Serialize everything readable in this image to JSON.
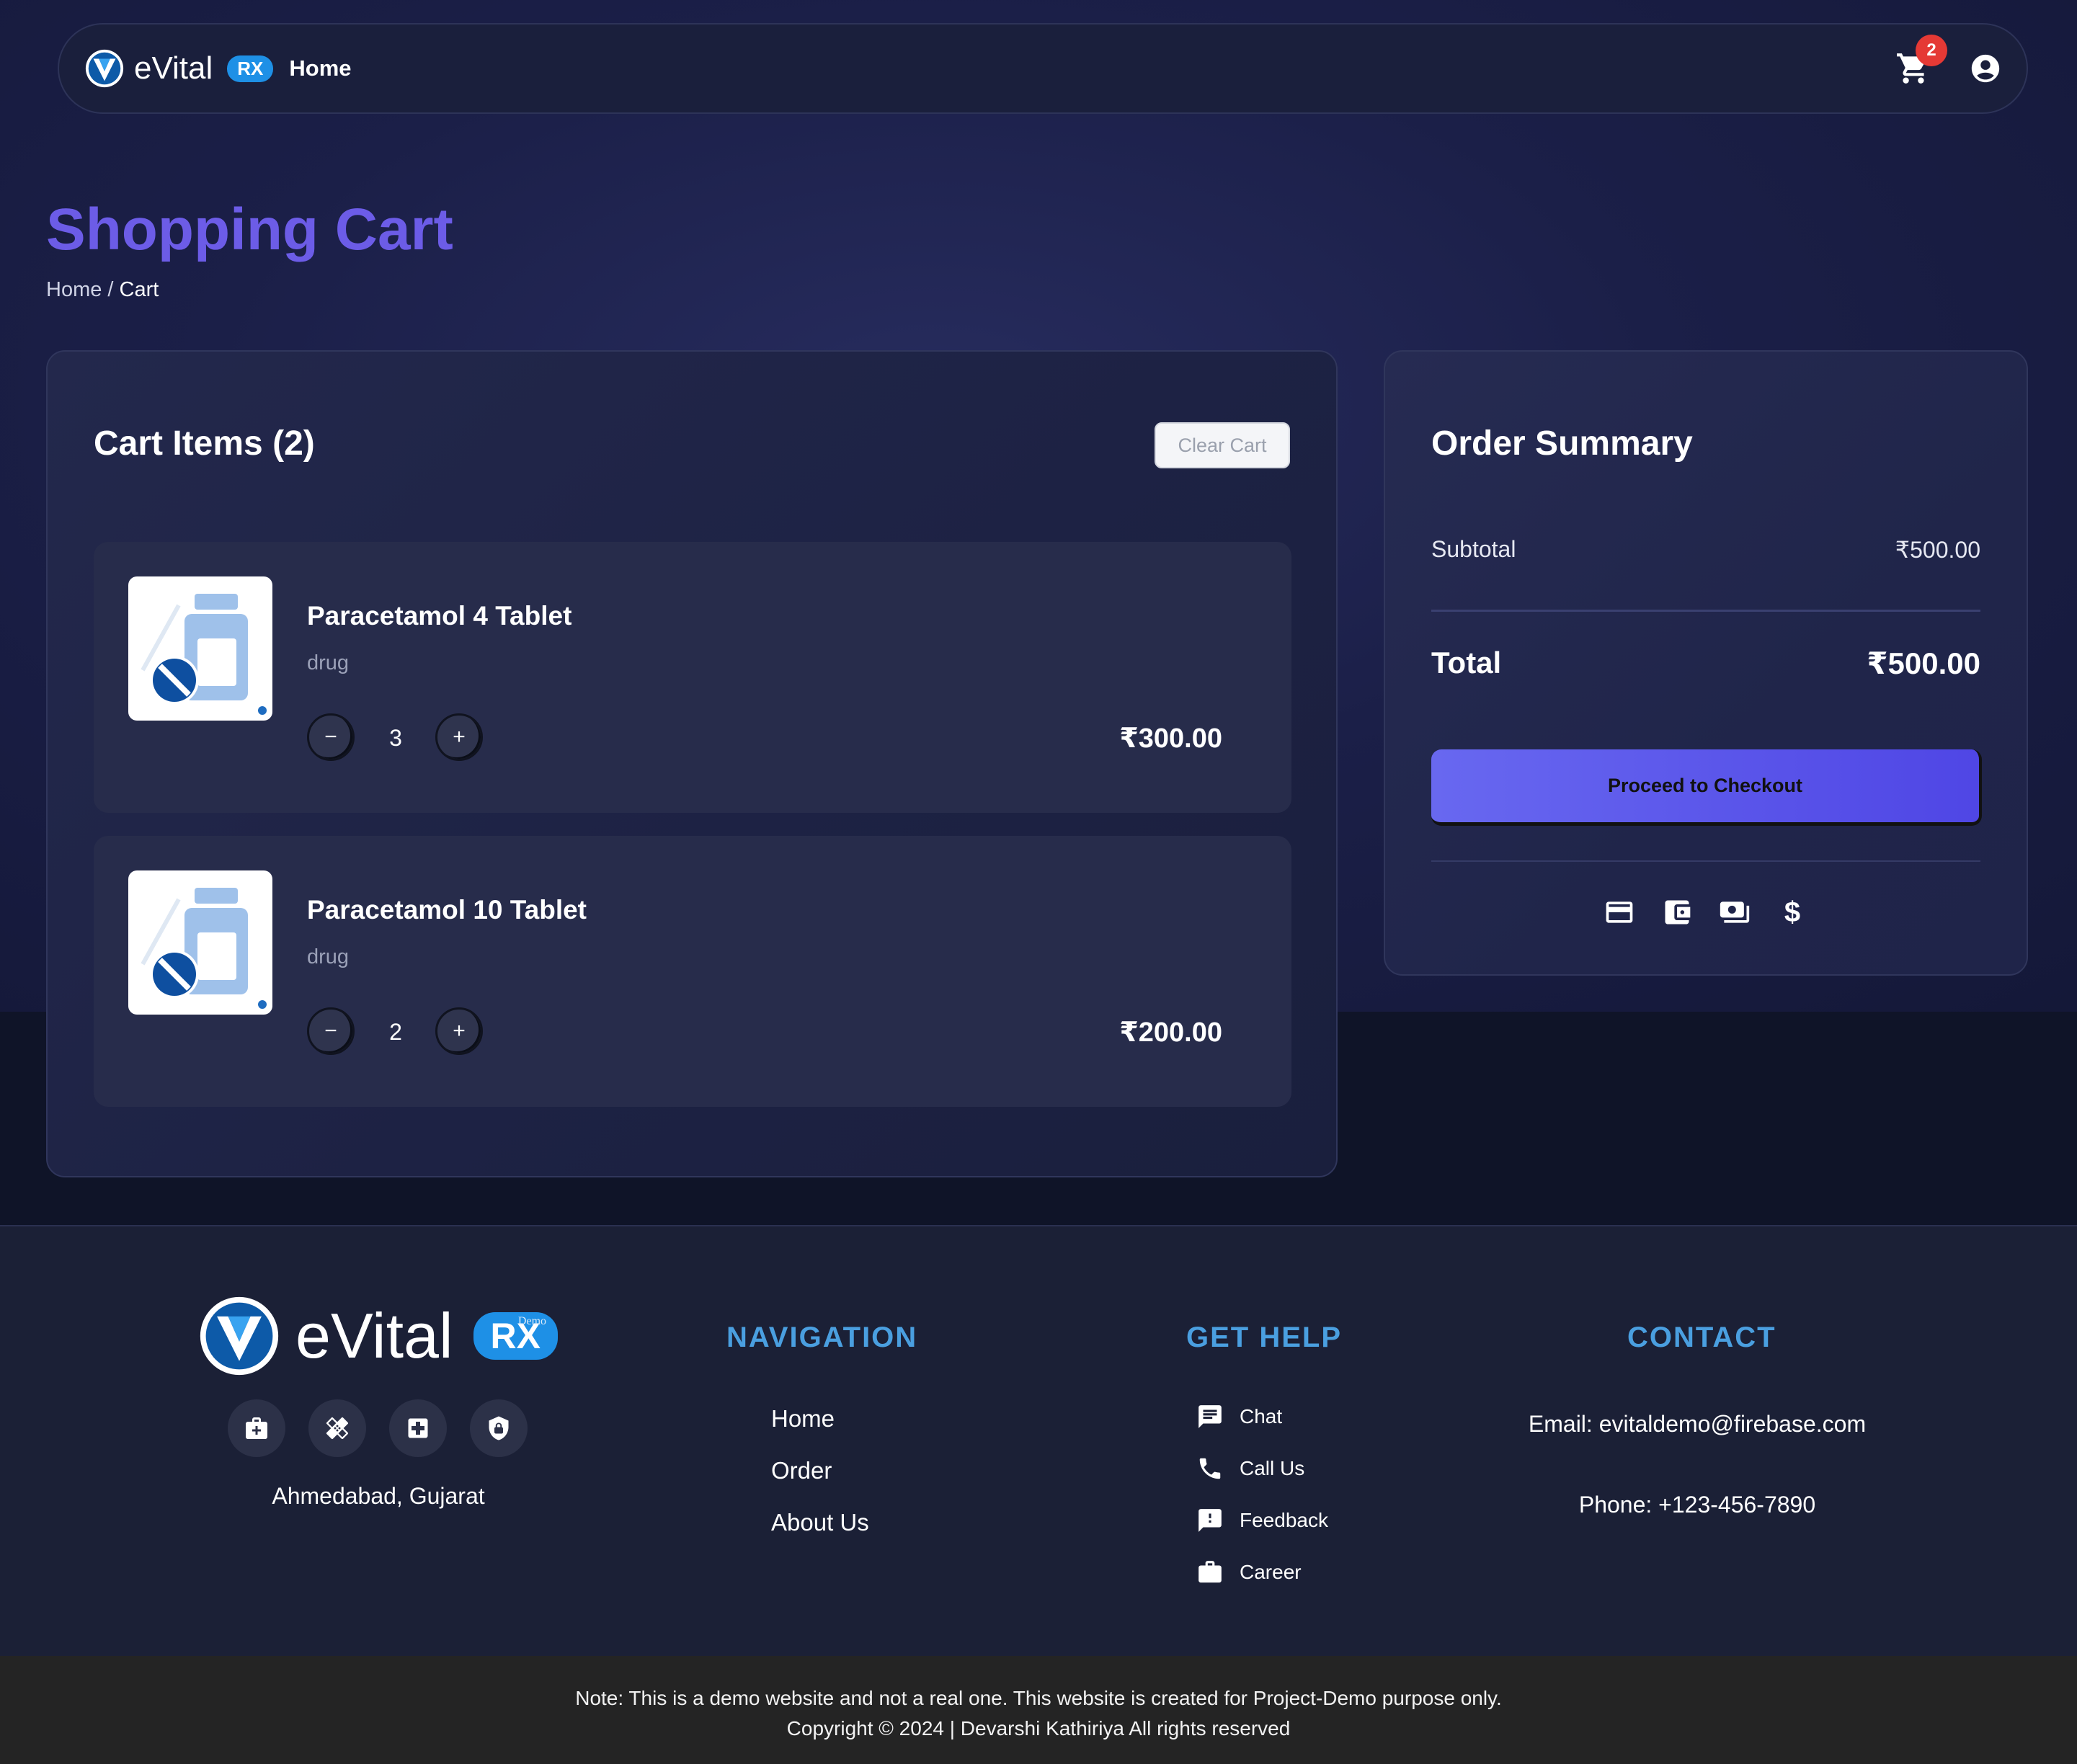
{
  "navbar": {
    "brand": "eVital",
    "brand_badge": "RX",
    "home_link": "Home",
    "cart_count": "2"
  },
  "header": {
    "title": "Shopping Cart",
    "breadcrumb_home": "Home",
    "breadcrumb_sep": "/",
    "breadcrumb_current": "Cart"
  },
  "cart": {
    "title": "Cart Items (2)",
    "clear_label": "Clear Cart",
    "items": [
      {
        "name": "Paracetamol 4 Tablet",
        "category": "drug",
        "quantity": "3",
        "price": "₹300.00"
      },
      {
        "name": "Paracetamol 10 Tablet",
        "category": "drug",
        "quantity": "2",
        "price": "₹200.00"
      }
    ],
    "decrement_symbol": "−",
    "increment_symbol": "+"
  },
  "summary": {
    "title": "Order Summary",
    "subtotal_label": "Subtotal",
    "subtotal_value": "₹500.00",
    "total_label": "Total",
    "total_value": "₹500.00",
    "checkout_label": "Proceed to Checkout",
    "payment_icons": [
      "credit-card-icon",
      "wallet-icon",
      "cash-icon",
      "dollar-icon"
    ],
    "dollar_glyph": "$"
  },
  "footer": {
    "brand": "eVital",
    "brand_badge": "RX",
    "brand_badge_note": "Demo",
    "social_icons": [
      "medical-kit-icon",
      "bandage-icon",
      "hospital-icon",
      "shield-icon"
    ],
    "location": "Ahmedabad, Gujarat",
    "navigation": {
      "heading": "NAVIGATION",
      "links": [
        "Home",
        "Order",
        "About Us"
      ]
    },
    "help": {
      "heading": "GET HELP",
      "items": [
        {
          "icon": "chat-icon",
          "label": "Chat"
        },
        {
          "icon": "phone-icon",
          "label": "Call Us"
        },
        {
          "icon": "feedback-icon",
          "label": "Feedback"
        },
        {
          "icon": "briefcase-icon",
          "label": "Career"
        }
      ]
    },
    "contact": {
      "heading": "CONTACT",
      "email": "Email: evitaldemo@firebase.com",
      "phone": "Phone: +123-456-7890"
    },
    "note": "Note: This is a demo website and not a real one. This website is created for Project-Demo purpose only.",
    "copyright": "Copyright © 2024 | Devarshi Kathiriya All rights reserved"
  },
  "colors": {
    "accent": "#6c5ce7",
    "footer_heading": "#4a9fe0",
    "badge": "#e53935",
    "rx_badge": "#1e90e6"
  }
}
